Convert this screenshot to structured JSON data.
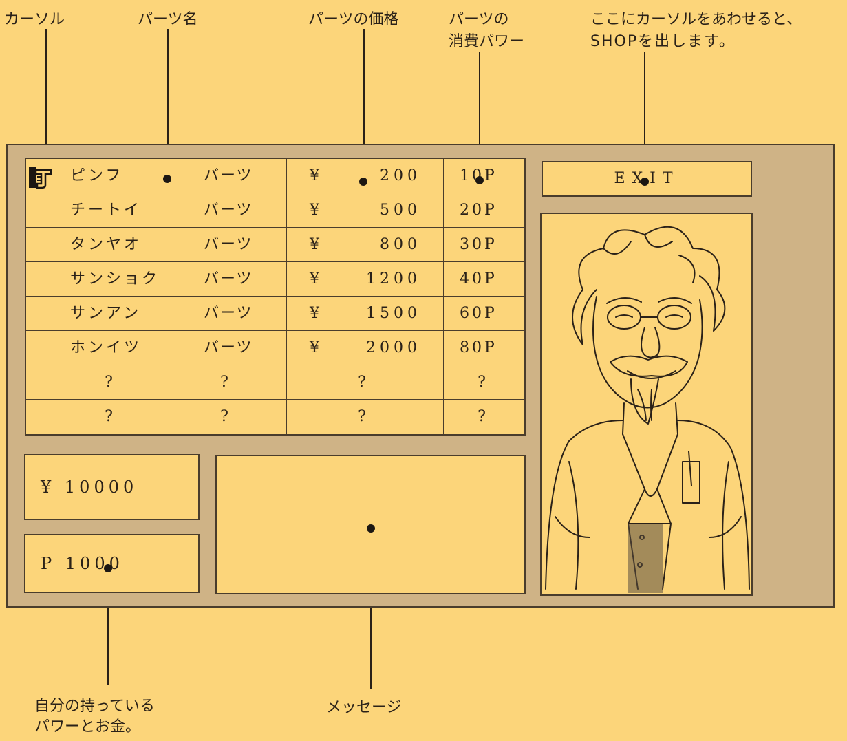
{
  "annotations": {
    "cursor": "カーソル",
    "part_name": "パーツ名",
    "part_price": "パーツの価格",
    "part_power_line1": "パーツの",
    "part_power_line2": "消費パワー",
    "exit_line1": "ここにカーソルをあわせると、",
    "exit_line2": "SHOPを出します。",
    "own_line1": "自分の持っている",
    "own_line2": "パワーとお金。",
    "message": "メッセージ"
  },
  "shop": {
    "items": [
      {
        "name": "ピンフ",
        "kind": "バーツ",
        "yen": "¥",
        "price": "200",
        "power": "10P"
      },
      {
        "name": "チートイ",
        "kind": "バーツ",
        "yen": "¥",
        "price": "500",
        "power": "20P"
      },
      {
        "name": "タンヤオ",
        "kind": "バーツ",
        "yen": "¥",
        "price": "800",
        "power": "30P"
      },
      {
        "name": "サンショク",
        "kind": "バーツ",
        "yen": "¥",
        "price": "1200",
        "power": "40P"
      },
      {
        "name": "サンアン",
        "kind": "バーツ",
        "yen": "¥",
        "price": "1500",
        "power": "60P"
      },
      {
        "name": "ホンイツ",
        "kind": "バーツ",
        "yen": "¥",
        "price": "2000",
        "power": "80P"
      },
      {
        "name": "?",
        "kind": "?",
        "yen": "",
        "price": "?",
        "power": "?"
      },
      {
        "name": "?",
        "kind": "?",
        "yen": "",
        "price": "?",
        "power": "?"
      }
    ],
    "exit_label": "EXIT",
    "money": "¥  10000",
    "power": "P  1000",
    "message": ""
  }
}
